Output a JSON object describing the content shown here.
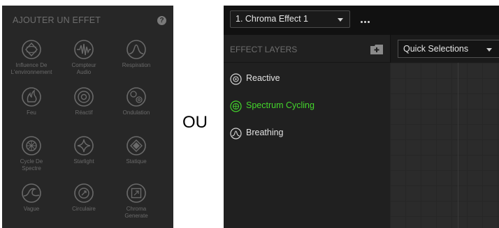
{
  "left_panel": {
    "title": "AJOUTER UN EFFET",
    "help_label": "?",
    "effects": [
      {
        "label": "Influence De\nL'environnement",
        "icon": "environment-icon"
      },
      {
        "label": "Compteur\nAudio",
        "icon": "audio-meter-icon"
      },
      {
        "label": "Respiration",
        "icon": "breathing-icon"
      },
      {
        "label": "Feu",
        "icon": "fire-icon"
      },
      {
        "label": "Réactif",
        "icon": "reactive-icon"
      },
      {
        "label": "Ondulation",
        "icon": "ripple-icon"
      },
      {
        "label": "Cycle De\nSpectre",
        "icon": "spectrum-cycling-icon"
      },
      {
        "label": "Starlight",
        "icon": "starlight-icon"
      },
      {
        "label": "Statique",
        "icon": "static-icon"
      },
      {
        "label": "Vague",
        "icon": "wave-icon"
      },
      {
        "label": "Circulaire",
        "icon": "circular-icon"
      },
      {
        "label": "Chroma\nGenerate",
        "icon": "chroma-generate-icon"
      }
    ]
  },
  "separator_text": "OU",
  "right_panel": {
    "effect_select": {
      "value": "1. Chroma Effect 1"
    },
    "more_label": "•••",
    "layers_title": "EFFECT LAYERS",
    "layers": [
      {
        "name": "Reactive",
        "active": false,
        "icon": "reactive-icon"
      },
      {
        "name": "Spectrum Cycling",
        "active": true,
        "icon": "spectrum-cycling-icon"
      },
      {
        "name": "Breathing",
        "active": false,
        "icon": "breathing-icon"
      }
    ],
    "quick_selections": {
      "value": "Quick Selections"
    }
  },
  "colors": {
    "accent_green": "#44d62c",
    "panel_bg": "#272727",
    "icon_gray": "#6a6a6a"
  }
}
